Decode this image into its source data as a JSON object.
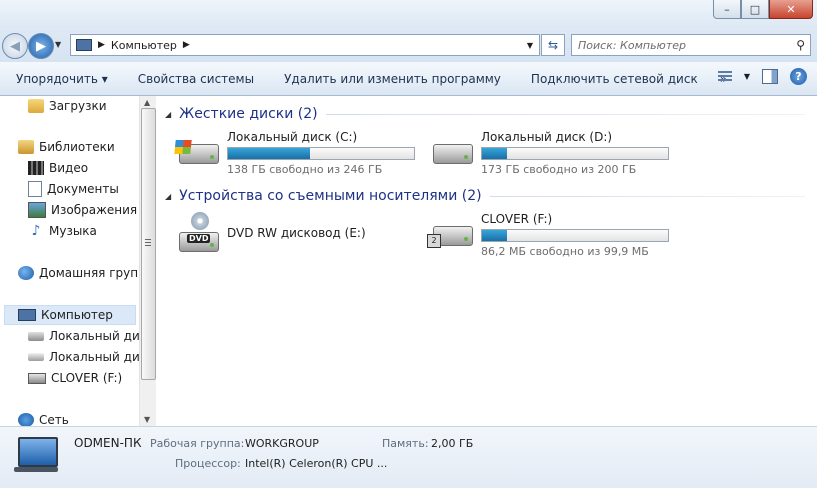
{
  "title_bar": {
    "minimize": "–",
    "maximize": "□",
    "close": "✕"
  },
  "address_bar": {
    "path": [
      "Компьютер"
    ],
    "search_placeholder": "Поиск: Компьютер"
  },
  "toolbar": {
    "organize": "Упорядочить ▾",
    "system_properties": "Свойства системы",
    "uninstall": "Удалить или изменить программу",
    "map_drive": "Подключить сетевой диск",
    "more": "»"
  },
  "sidebar": {
    "downloads": "Загрузки",
    "libraries": "Библиотеки",
    "video": "Видео",
    "documents": "Документы",
    "images": "Изображения",
    "music": "Музыка",
    "homegroup": "Домашняя группа",
    "computer": "Компьютер",
    "local_c": "Локальный диск",
    "local_d": "Локальный диск",
    "clover": "CLOVER (F:)",
    "network": "Сеть"
  },
  "groups": {
    "hard_drives": "Жесткие диски (2)",
    "removable": "Устройства со съемными носителями (2)"
  },
  "drives": {
    "c": {
      "name": "Локальный диск (C:)",
      "free": "138 ГБ свободно из 246 ГБ",
      "used_fraction": 0.44
    },
    "d": {
      "name": "Локальный диск (D:)",
      "free": "173 ГБ свободно из 200 ГБ",
      "used_fraction": 0.135
    },
    "dvd": {
      "name": "DVD RW дисковод (E:)",
      "badge": "DVD"
    },
    "clover": {
      "name": "CLOVER (F:)",
      "free": "86,2 МБ свободно из 99,9 МБ",
      "used_fraction": 0.137
    }
  },
  "details": {
    "computer_name": "ODMEN-ПК",
    "workgroup_label": "Рабочая группа:",
    "workgroup_value": "WORKGROUP",
    "memory_label": "Память:",
    "memory_value": "2,00 ГБ",
    "processor_label": "Процессор:",
    "processor_value": "Intel(R) Celeron(R) CPU ..."
  },
  "colors": {
    "group_header": "#1e3287",
    "bar_fill": "#1a6fa7",
    "selected_bg": "#dbe8f7"
  }
}
